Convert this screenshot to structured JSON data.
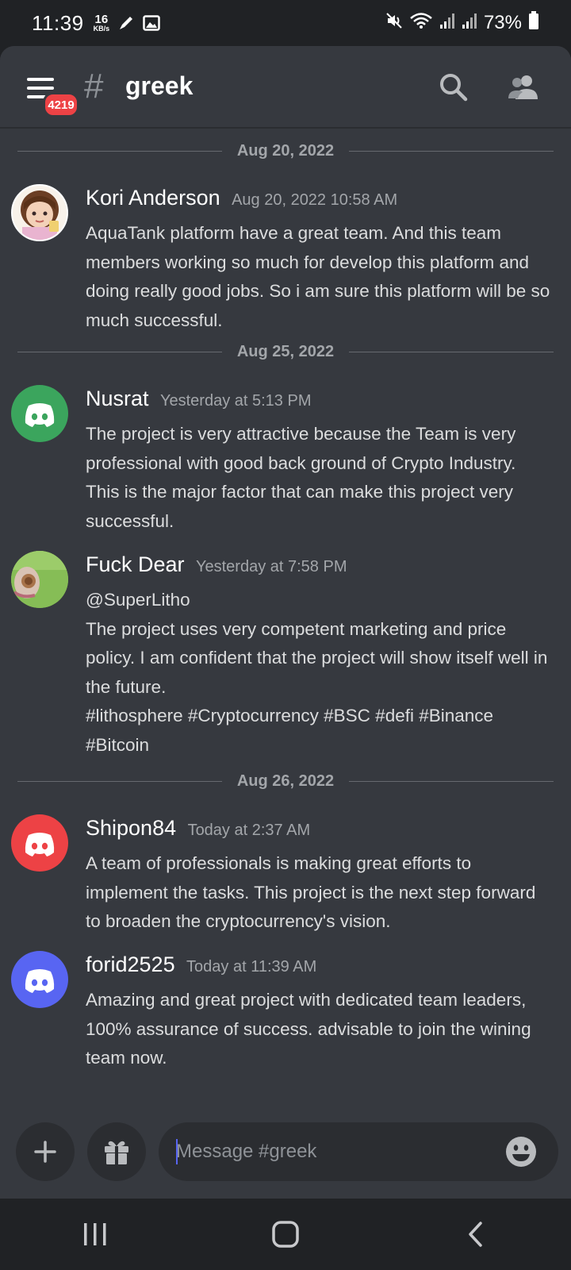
{
  "status_bar": {
    "time": "11:39",
    "net_speed_value": "16",
    "net_speed_unit": "KB/s",
    "battery_pct": "73%",
    "icons": [
      "pen-icon",
      "image-icon",
      "mute-icon",
      "wifi-icon",
      "signal-icon",
      "signal-icon",
      "battery-icon"
    ]
  },
  "header": {
    "menu_badge": "4219",
    "channel_hash": "#",
    "channel_name": "greek",
    "icons": [
      "menu-icon",
      "search-icon",
      "members-icon"
    ]
  },
  "messages": [
    {
      "type": "divider",
      "label": "Aug 20, 2022"
    },
    {
      "type": "message",
      "author": "Kori Anderson",
      "timestamp": "Aug 20, 2022 10:58 AM",
      "avatar": "photo",
      "lines": [
        "AquaTank platform have a great team. And this team members working so much for develop this platform and doing really good jobs. So i am sure this platform will be so much successful."
      ]
    },
    {
      "type": "divider",
      "label": "Aug 25, 2022"
    },
    {
      "type": "message",
      "author": "Nusrat",
      "timestamp": "Yesterday at 5:13 PM",
      "avatar": "discord-default",
      "avatar_color": "#3ba55d",
      "lines": [
        "The project is very attractive because the Team is very professional with good back ground of Crypto Industry. This is the major factor that can make this project very successful."
      ]
    },
    {
      "type": "message",
      "author": "Fuck Dear",
      "timestamp": "Yesterday at 7:58 PM",
      "avatar": "photo",
      "lines": [
        "@SuperLitho",
        "The project uses very competent marketing and price policy. I am confident that the project will show itself well in the future.",
        "#lithosphere #Cryptocurrency #BSC #defi #Binance #Bitcoin"
      ]
    },
    {
      "type": "divider",
      "label": "Aug 26, 2022"
    },
    {
      "type": "message",
      "author": "Shipon84",
      "timestamp": "Today at 2:37 AM",
      "avatar": "discord-default",
      "avatar_color": "#ed4245",
      "lines": [
        "A team of professionals is making great efforts to implement the tasks. This project is the next step forward to broaden the cryptocurrency's vision."
      ]
    },
    {
      "type": "message",
      "author": "forid2525",
      "timestamp": "Today at 11:39 AM",
      "avatar": "discord-default",
      "avatar_color": "#5865f2",
      "lines": [
        "Amazing and great project with dedicated team leaders, 100% assurance of success. advisable to join the wining team now."
      ]
    }
  ],
  "composer": {
    "placeholder": "Message #greek",
    "icons": [
      "plus-icon",
      "gift-icon",
      "emoji-icon"
    ]
  },
  "nav_bar": {
    "icons": [
      "recent-apps-icon",
      "home-icon",
      "back-icon"
    ]
  },
  "colors": {
    "background": "#36393f",
    "status_bar": "#202225",
    "blurple": "#5865f2",
    "green": "#3ba55d",
    "red": "#ed4245"
  }
}
